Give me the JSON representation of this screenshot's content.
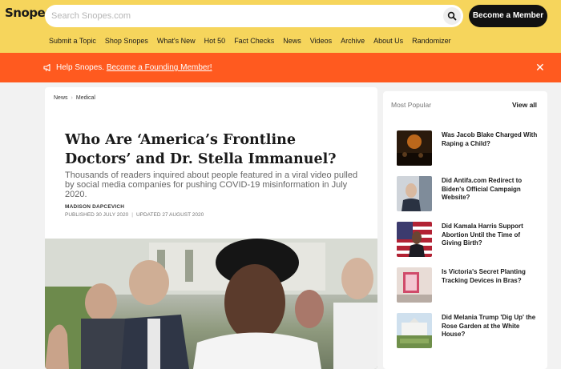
{
  "header": {
    "logo_text": "Snopes",
    "search_placeholder": "Search Snopes.com",
    "member_button": "Become a Member",
    "nav": [
      "Submit a Topic",
      "Shop Snopes",
      "What's New",
      "Hot 50",
      "Fact Checks",
      "News",
      "Videos",
      "Archive",
      "About Us",
      "Randomizer"
    ]
  },
  "banner": {
    "text": "Help Snopes.",
    "link": "Become a Founding Member!",
    "close": "✕"
  },
  "article": {
    "breadcrumb": [
      "News",
      "Medical"
    ],
    "title": "Who Are ‘America’s Frontline Doctors’ and Dr. Stella Immanuel?",
    "subtitle": "Thousands of readers inquired about people featured in a viral video pulled by social media companies for pushing COVID-19 misinformation in July 2020.",
    "author": "MADISON DAPCEVICH",
    "published": "PUBLISHED 30 JULY 2020",
    "updated": "UPDATED 27 AUGUST 2020"
  },
  "sidebar": {
    "heading": "Most Popular",
    "view_all": "View all",
    "items": [
      {
        "title": "Was Jacob Blake Charged With Raping a Child?",
        "thumb": "night-crowd-photo"
      },
      {
        "title": "Did Antifa.com Redirect to Biden's Official Campaign Website?",
        "thumb": "biden-photo"
      },
      {
        "title": "Did Kamala Harris Support Abortion Until the Time of Giving Birth?",
        "thumb": "harris-flag-photo"
      },
      {
        "title": "Is Victoria's Secret Planting Tracking Devices in Bras?",
        "thumb": "store-photo"
      },
      {
        "title": "Did Melania Trump 'Dig Up' the Rose Garden at the White House?",
        "thumb": "white-house-photo"
      }
    ]
  },
  "colors": {
    "header_bg": "#f6d55c",
    "banner_bg": "#ff5a1f",
    "page_bg": "#f2f2f2"
  }
}
